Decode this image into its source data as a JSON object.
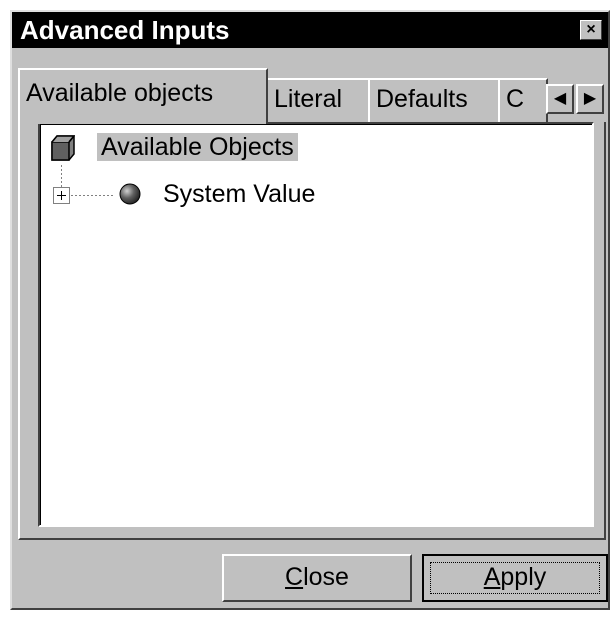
{
  "window": {
    "title": "Advanced Inputs",
    "close_glyph": "×"
  },
  "tabs": [
    {
      "label": "Available objects",
      "active": true
    },
    {
      "label": "Literal",
      "active": false
    },
    {
      "label": "Defaults",
      "active": false
    },
    {
      "label": "C",
      "active": false
    }
  ],
  "tab_scroll": {
    "left_glyph": "◀",
    "right_glyph": "▶"
  },
  "tree": {
    "root": {
      "label": "Available Objects",
      "icon": "cube-icon",
      "selected": true
    },
    "children": [
      {
        "label": "System Value",
        "icon": "sphere-icon",
        "expander": "+"
      }
    ]
  },
  "buttons": {
    "close": {
      "label": "Close",
      "mnemonic": "C"
    },
    "apply": {
      "label": "Apply",
      "mnemonic": "A"
    }
  }
}
